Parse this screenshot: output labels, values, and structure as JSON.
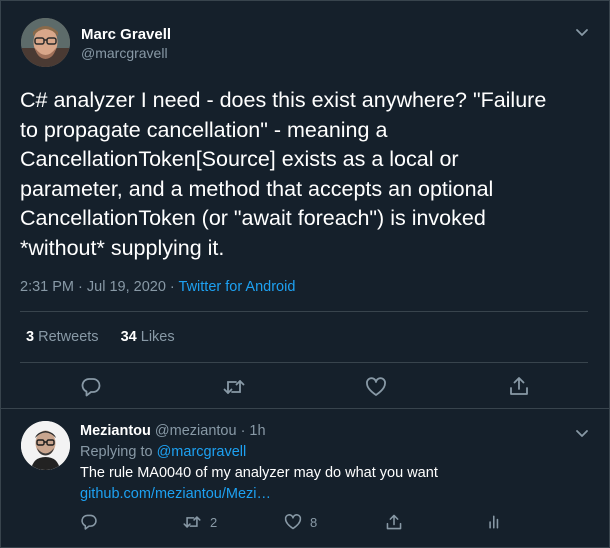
{
  "tweet": {
    "author_name": "Marc Gravell",
    "author_handle": "@marcgravell",
    "text": "C# analyzer I need - does this exist anywhere? \"Failure\nto propagate cancellation\" - meaning a\nCancellationToken[Source] exists as a local or\nparameter, and a method that accepts an optional\nCancellationToken (or \"await foreach\") is invoked\n*without* supplying it.",
    "timestamp": "2:31 PM · Jul 19, 2020 · ",
    "source": "Twitter for Android",
    "retweet_count": "3",
    "retweet_label": "Retweets",
    "like_count": "34",
    "like_label": "Likes"
  },
  "reply": {
    "author_name": "Meziantou",
    "author_handle": "@meziantou",
    "time": " · 1h",
    "replying_prefix": "Replying to ",
    "replying_to": "@marcgravell",
    "text": "The rule MA0040 of my analyzer may do what you want",
    "link": "github.com/meziantou/Mezi…",
    "retweet_count": "2",
    "like_count": "8"
  },
  "icons": {
    "reply": "reply-icon",
    "retweet": "retweet-icon",
    "like": "heart-icon",
    "share": "share-icon",
    "analytics": "analytics-icon",
    "more": "chevron-down-icon"
  },
  "colors": {
    "background": "#15202b",
    "border": "#38444d",
    "text": "#ffffff",
    "secondary": "#8899a6",
    "accent": "#1da1f2"
  }
}
